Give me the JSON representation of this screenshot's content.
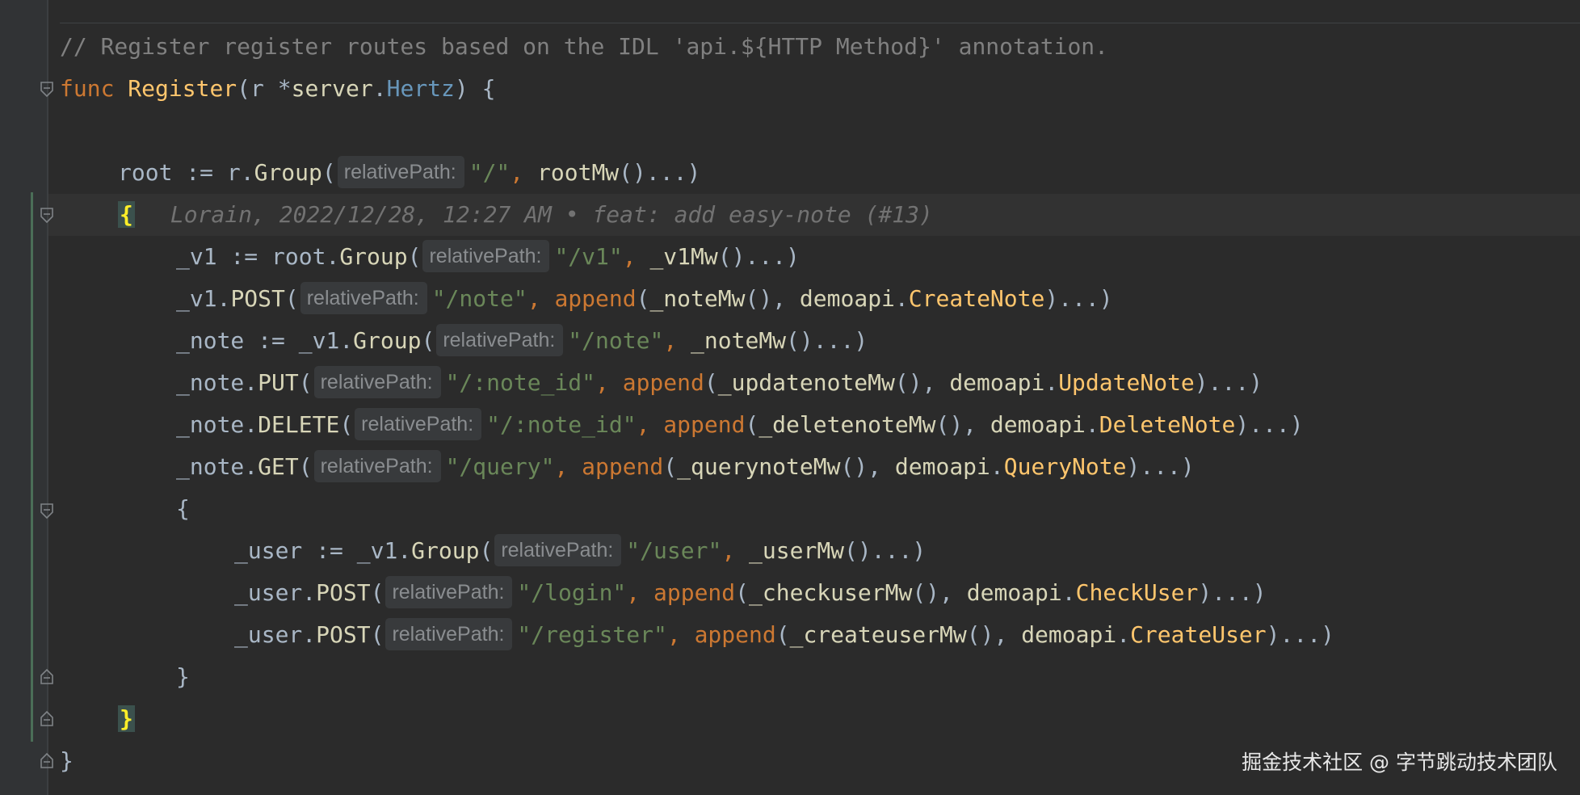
{
  "editor": {
    "comment": "// Register register routes based on the IDL 'api.${HTTP Method}' annotation.",
    "hint_label": "relativePath:",
    "blame": "Lorain, 2022/12/28, 12:27 AM • feat: add easy-note (#13)",
    "tokens": {
      "func": "func",
      "register": "Register",
      "r": "r",
      "server": "server",
      "hertz": "Hertz",
      "open_paren": "(",
      "close_paren": ")",
      "open_brace": "{",
      "close_brace": "}",
      "star": " *",
      "dot": ".",
      "space_brace": " {",
      "root": "root",
      "v1": "_v1",
      "note": "_note",
      "user": "_user",
      "assign": " := ",
      "group": "Group",
      "post": "POST",
      "put": "PUT",
      "delete": "DELETE",
      "get": "GET",
      "comma": ", ",
      "append": "append",
      "demoapi": "demoapi",
      "ellipsis_close": ")...)",
      "call_ellipsis": "()...)",
      "call_comma": "(), ",
      "path_root": "\"/\"",
      "path_v1": "\"/v1\"",
      "path_note": "\"/note\"",
      "path_note_id": "\"/:note_id\"",
      "path_query": "\"/query\"",
      "path_user": "\"/user\"",
      "path_login": "\"/login\"",
      "path_register": "\"/register\"",
      "rootMw": "rootMw",
      "v1Mw": "_v1Mw",
      "noteMw": "_noteMw",
      "updatenoteMw": "_updatenoteMw",
      "deletenoteMw": "_deletenoteMw",
      "querynoteMw": "_querynoteMw",
      "userMw": "_userMw",
      "checkuserMw": "_checkuserMw",
      "createuserMw": "_createuserMw",
      "CreateNote": "CreateNote",
      "UpdateNote": "UpdateNote",
      "DeleteNote": "DeleteNote",
      "QueryNote": "QueryNote",
      "CheckUser": "CheckUser",
      "CreateUser": "CreateUser"
    }
  },
  "watermark": "掘金技术社区 @ 字节跳动技术团队",
  "colors": {
    "background": "#2b2b2b",
    "keyword": "#cc7832",
    "function": "#ffc66d",
    "string": "#6a8759",
    "comment": "#808080",
    "type": "#6897bb",
    "brace_highlight": "#ffef28"
  }
}
